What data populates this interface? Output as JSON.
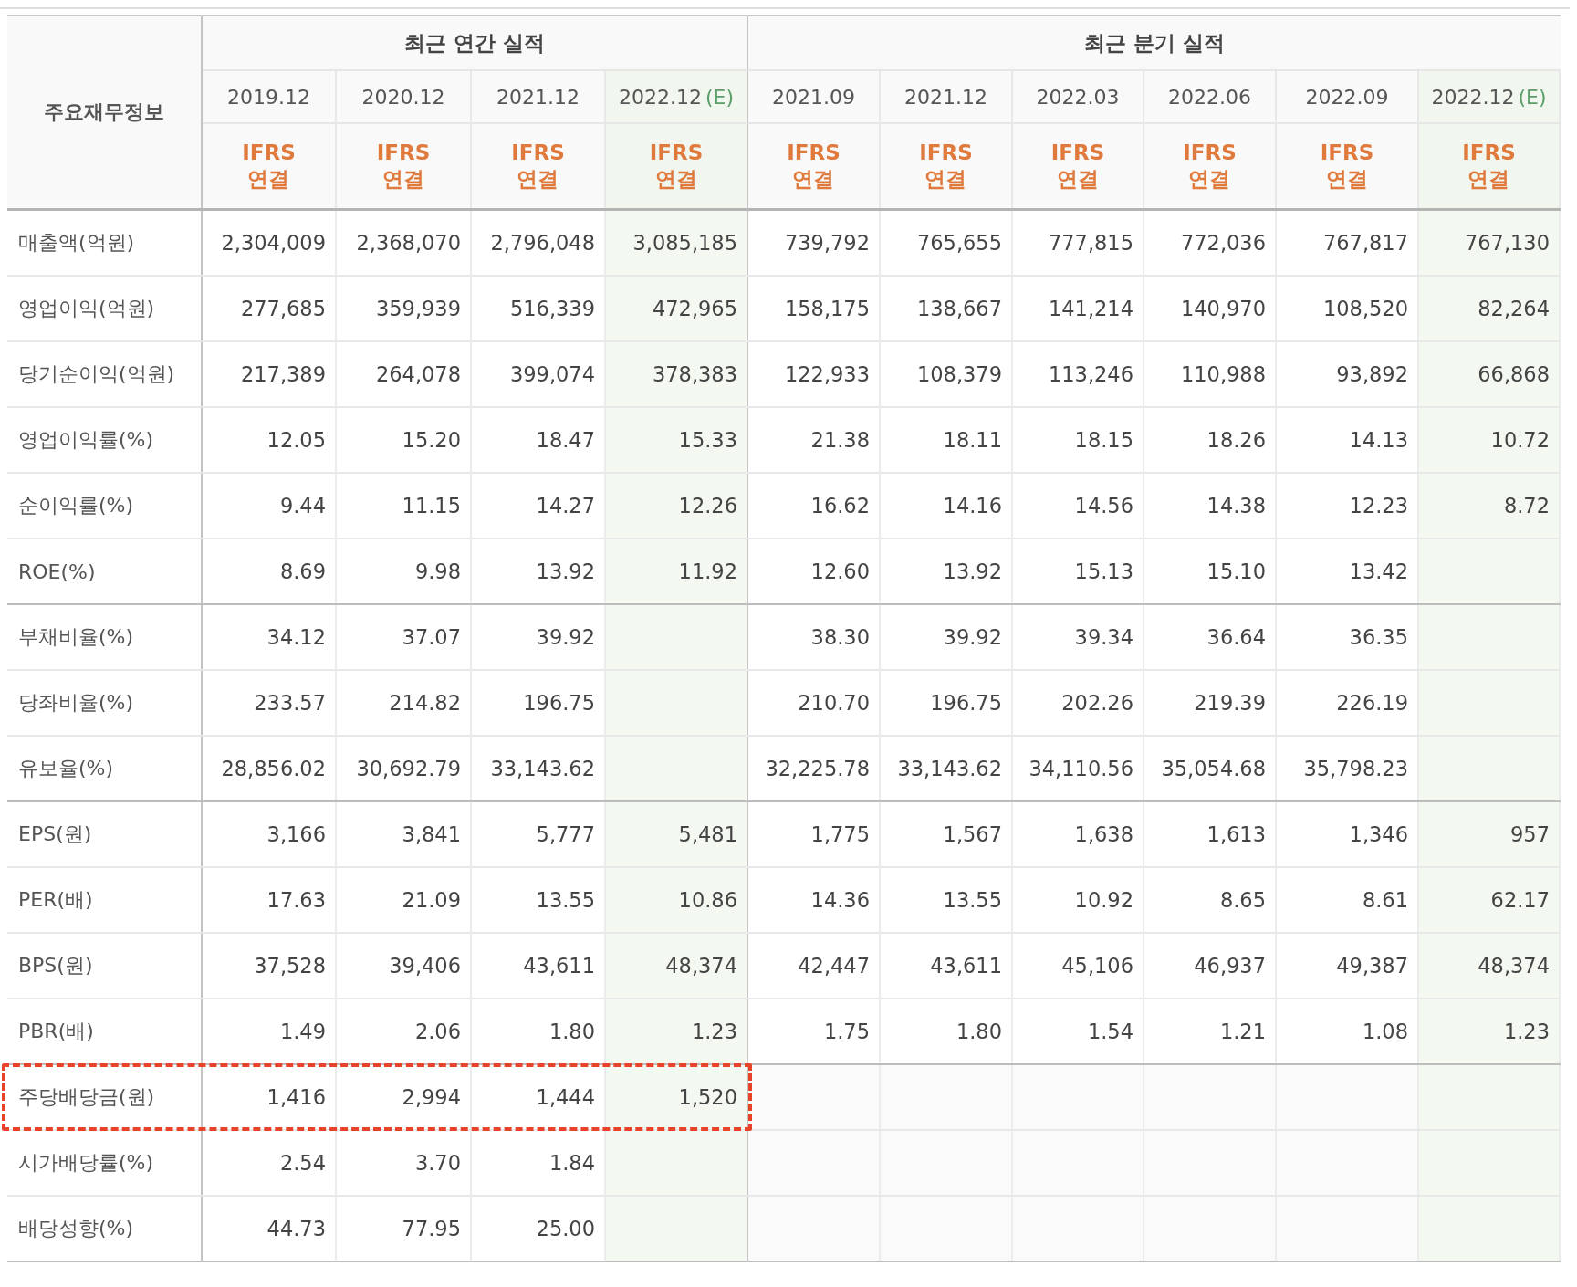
{
  "header": {
    "label": "주요재무정보",
    "groups": [
      {
        "title": "최근 연간 실적",
        "columns": [
          {
            "period": "2019.12",
            "basis": [
              "IFRS",
              "연결"
            ]
          },
          {
            "period": "2020.12",
            "basis": [
              "IFRS",
              "연결"
            ]
          },
          {
            "period": "2021.12",
            "basis": [
              "IFRS",
              "연결"
            ]
          },
          {
            "period": "2022.12",
            "mark": "(E)",
            "basis": [
              "IFRS",
              "연결"
            ]
          }
        ]
      },
      {
        "title": "최근 분기 실적",
        "columns": [
          {
            "period": "2021.09",
            "basis": [
              "IFRS",
              "연결"
            ]
          },
          {
            "period": "2021.12",
            "basis": [
              "IFRS",
              "연결"
            ]
          },
          {
            "period": "2022.03",
            "basis": [
              "IFRS",
              "연결"
            ]
          },
          {
            "period": "2022.06",
            "basis": [
              "IFRS",
              "연결"
            ]
          },
          {
            "period": "2022.09",
            "basis": [
              "IFRS",
              "연결"
            ]
          },
          {
            "period": "2022.12",
            "mark": "(E)",
            "basis": [
              "IFRS",
              "연결"
            ]
          }
        ]
      }
    ]
  },
  "groups": [
    {
      "rows": [
        {
          "label": "매출액(억원)",
          "highlighted": false,
          "annual": [
            "2,304,009",
            "2,368,070",
            "2,796,048",
            "3,085,185"
          ],
          "quarterly": [
            "739,792",
            "765,655",
            "777,815",
            "772,036",
            "767,817",
            "767,130"
          ]
        },
        {
          "label": "영업이익(억원)",
          "highlighted": false,
          "annual": [
            "277,685",
            "359,939",
            "516,339",
            "472,965"
          ],
          "quarterly": [
            "158,175",
            "138,667",
            "141,214",
            "140,970",
            "108,520",
            "82,264"
          ]
        },
        {
          "label": "당기순이익(억원)",
          "highlighted": false,
          "annual": [
            "217,389",
            "264,078",
            "399,074",
            "378,383"
          ],
          "quarterly": [
            "122,933",
            "108,379",
            "113,246",
            "110,988",
            "93,892",
            "66,868"
          ]
        },
        {
          "label": "영업이익률(%)",
          "highlighted": false,
          "annual": [
            "12.05",
            "15.20",
            "18.47",
            "15.33"
          ],
          "quarterly": [
            "21.38",
            "18.11",
            "18.15",
            "18.26",
            "14.13",
            "10.72"
          ]
        },
        {
          "label": "순이익률(%)",
          "highlighted": false,
          "annual": [
            "9.44",
            "11.15",
            "14.27",
            "12.26"
          ],
          "quarterly": [
            "16.62",
            "14.16",
            "14.56",
            "14.38",
            "12.23",
            "8.72"
          ]
        },
        {
          "label": "ROE(%)",
          "highlighted": false,
          "annual": [
            "8.69",
            "9.98",
            "13.92",
            "11.92"
          ],
          "quarterly": [
            "12.60",
            "13.92",
            "15.13",
            "15.10",
            "13.42"
          ]
        }
      ]
    },
    {
      "rows": [
        {
          "label": "부채비율(%)",
          "highlighted": false,
          "annual": [
            "34.12",
            "37.07",
            "39.92"
          ],
          "quarterly": [
            "38.30",
            "39.92",
            "39.34",
            "36.64",
            "36.35"
          ]
        },
        {
          "label": "당좌비율(%)",
          "highlighted": false,
          "annual": [
            "233.57",
            "214.82",
            "196.75"
          ],
          "quarterly": [
            "210.70",
            "196.75",
            "202.26",
            "219.39",
            "226.19"
          ]
        },
        {
          "label": "유보율(%)",
          "highlighted": false,
          "annual": [
            "28,856.02",
            "30,692.79",
            "33,143.62"
          ],
          "quarterly": [
            "32,225.78",
            "33,143.62",
            "34,110.56",
            "35,054.68",
            "35,798.23"
          ]
        }
      ]
    },
    {
      "rows": [
        {
          "label": "EPS(원)",
          "highlighted": false,
          "annual": [
            "3,166",
            "3,841",
            "5,777",
            "5,481"
          ],
          "quarterly": [
            "1,775",
            "1,567",
            "1,638",
            "1,613",
            "1,346",
            "957"
          ]
        },
        {
          "label": "PER(배)",
          "highlighted": false,
          "annual": [
            "17.63",
            "21.09",
            "13.55",
            "10.86"
          ],
          "quarterly": [
            "14.36",
            "13.55",
            "10.92",
            "8.65",
            "8.61",
            "62.17"
          ]
        },
        {
          "label": "BPS(원)",
          "highlighted": false,
          "annual": [
            "37,528",
            "39,406",
            "43,611",
            "48,374"
          ],
          "quarterly": [
            "42,447",
            "43,611",
            "45,106",
            "46,937",
            "49,387",
            "48,374"
          ]
        },
        {
          "label": "PBR(배)",
          "highlighted": false,
          "annual": [
            "1.49",
            "2.06",
            "1.80",
            "1.23"
          ],
          "quarterly": [
            "1.75",
            "1.80",
            "1.54",
            "1.21",
            "1.08",
            "1.23"
          ]
        }
      ]
    },
    {
      "rows": [
        {
          "label": "주당배당금(원)",
          "highlighted": true,
          "annual": [
            "1,416",
            "2,994",
            "1,444",
            "1,520"
          ]
        },
        {
          "label": "시가배당률(%)",
          "highlighted": false,
          "annual": [
            "2.54",
            "3.70",
            "1.84"
          ]
        },
        {
          "label": "배당성향(%)",
          "highlighted": false,
          "annual": [
            "44.73",
            "77.95",
            "25.00"
          ]
        }
      ]
    }
  ]
}
